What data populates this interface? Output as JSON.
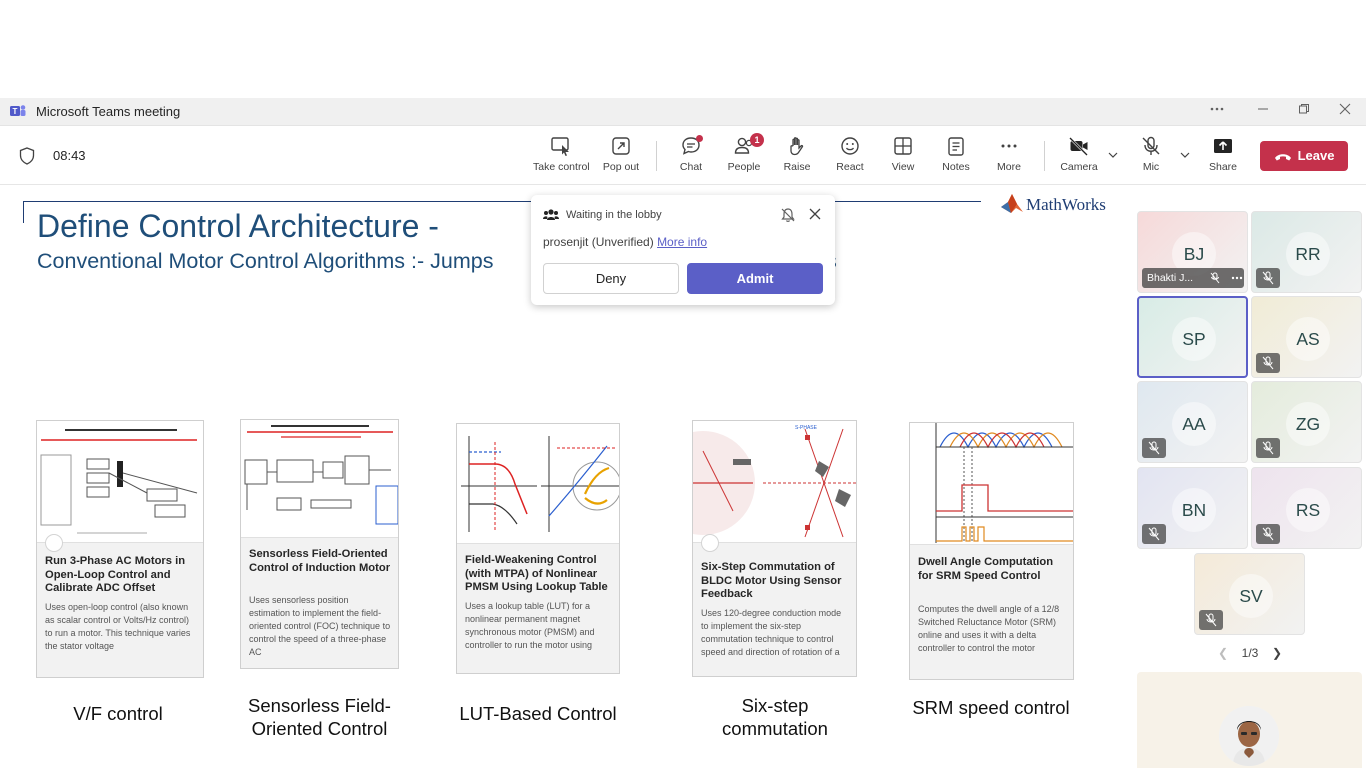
{
  "window": {
    "title": "Microsoft Teams meeting",
    "more_icon": "ellipsis-icon",
    "controls": [
      "minimize",
      "restore",
      "close"
    ]
  },
  "meeting": {
    "elapsed_time": "08:43"
  },
  "toolbar": {
    "take_control": "Take control",
    "pop_out": "Pop out",
    "chat": "Chat",
    "people": "People",
    "people_badge": "1",
    "raise": "Raise",
    "react": "React",
    "view": "View",
    "notes": "Notes",
    "more": "More",
    "camera": "Camera",
    "mic": "Mic",
    "share": "Share",
    "leave": "Leave"
  },
  "slide": {
    "logo": "MathWorks",
    "title": "Define Control Architecture -",
    "subtitle": "Conventional Motor Control Algorithms :- Jumps",
    "subtitle_tail": "s",
    "cards": [
      {
        "title": "Run 3-Phase AC Motors in Open-Loop Control and Calibrate ADC Offset",
        "desc": "Uses open-loop control (also known as scalar control or Volts/Hz control) to run a motor. This technique varies the stator voltage",
        "caption": "V/F control"
      },
      {
        "title": "Sensorless Field-Oriented Control of Induction Motor",
        "desc": "Uses sensorless position estimation to implement the field-oriented control (FOC) technique to control the speed of a three-phase AC",
        "caption": "Sensorless Field-Oriented Control"
      },
      {
        "title": "Field-Weakening Control (with MTPA) of Nonlinear PMSM Using Lookup Table",
        "desc": "Uses a lookup table (LUT) for a nonlinear permanent magnet synchronous motor (PMSM) and controller to run the motor using",
        "caption": "LUT-Based Control"
      },
      {
        "title": "Six-Step Commutation of BLDC Motor Using Sensor Feedback",
        "desc": "Uses 120-degree conduction mode to implement the six-step commutation technique to control speed and direction of rotation of a",
        "caption": "Six-step commutation"
      },
      {
        "title": "Dwell Angle Computation for SRM Speed Control",
        "desc": "Computes the dwell angle of a 12/8 Switched Reluctance Motor (SRM) online and uses it with a delta controller to control the motor",
        "caption": "SRM speed control"
      }
    ]
  },
  "lobby": {
    "header": "Waiting in the lobby",
    "person": "prosenjit (Unverified)",
    "more_info": "More info",
    "deny": "Deny",
    "admit": "Admit"
  },
  "participants": [
    {
      "initials": "BJ",
      "name": "Bhakti J...",
      "color": "#f6d9d9"
    },
    {
      "initials": "RR",
      "name": "",
      "color": "#dbe9e6"
    },
    {
      "initials": "SP",
      "name": "",
      "color": "#d8ece6"
    },
    {
      "initials": "AS",
      "name": "",
      "color": "#f1ecd6"
    },
    {
      "initials": "AA",
      "name": "",
      "color": "#dfe8f0"
    },
    {
      "initials": "ZG",
      "name": "",
      "color": "#e4ecdc"
    },
    {
      "initials": "BN",
      "name": "",
      "color": "#e2e4f2"
    },
    {
      "initials": "RS",
      "name": "",
      "color": "#eee3ee"
    },
    {
      "initials": "SV",
      "name": "",
      "color": "#f4ead8"
    }
  ],
  "pager": {
    "text": "1/3"
  },
  "colors": {
    "accent": "#5b5fc7",
    "leave": "#c4314b",
    "slide_title": "#1f4e79"
  }
}
